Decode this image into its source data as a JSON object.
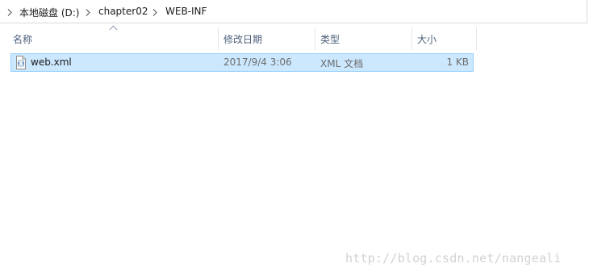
{
  "breadcrumb": {
    "items": [
      "本地磁盘 (D:)",
      "chapter02",
      "WEB-INF"
    ]
  },
  "columns": {
    "name": "名称",
    "date_modified": "修改日期",
    "type": "类型",
    "size": "大小",
    "sorted_by": "name",
    "sort_direction": "ascending"
  },
  "files": [
    {
      "name": "web.xml",
      "date_modified": "2017/9/4 3:06",
      "type": "XML 文档",
      "size": "1 KB",
      "icon": "xml-file-icon",
      "selected": true
    }
  ],
  "watermark": "http://blog.csdn.net/nangeali",
  "colors": {
    "selection_fill": "#cce8ff",
    "selection_border": "#99d1ff",
    "header_text": "#4c607a",
    "secondary_text": "#6d6d6d"
  }
}
